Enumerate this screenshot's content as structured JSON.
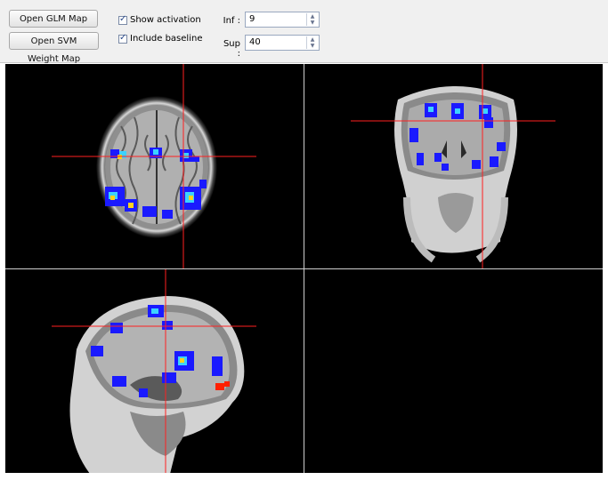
{
  "toolbar": {
    "open_glm_label": "Open GLM Map",
    "open_svm_label": "Open SVM Weight Map",
    "show_activation_label": "Show activation",
    "show_activation_checked": true,
    "include_baseline_label": "Include baseline",
    "include_baseline_checked": true,
    "inf_label": "Inf :",
    "inf_value": "9",
    "sup_label": "Sup :",
    "sup_value": "40"
  },
  "colors": {
    "crosshair": "#ff2020",
    "activation_low": "#1a1aff",
    "activation_high": "#ff2000"
  },
  "viewer": {
    "panes": [
      "axial-view",
      "coronal-view",
      "sagittal-view",
      "empty-view"
    ]
  }
}
